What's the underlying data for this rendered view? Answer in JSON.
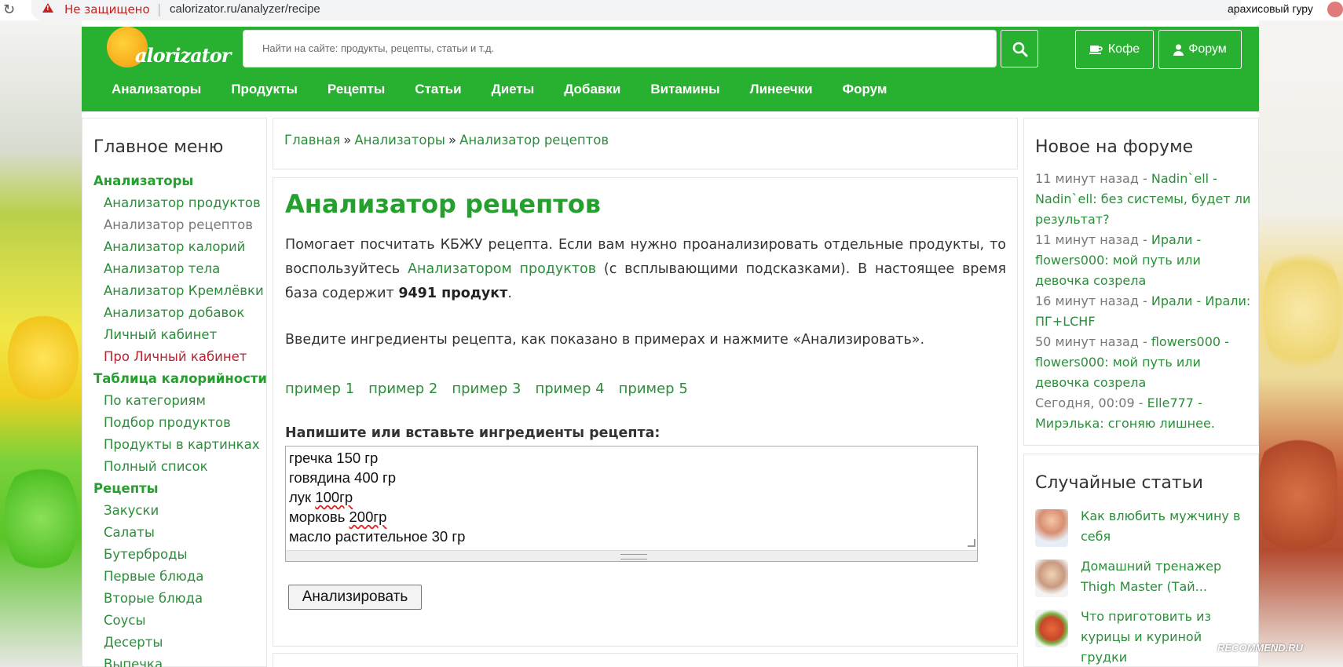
{
  "browser": {
    "not_secure": "Не защищено",
    "url": "calorizator.ru/analyzer/recipe",
    "profile_name": "арахисовый гуру"
  },
  "header": {
    "logo_text": "alorizator",
    "search_placeholder": "Найти на сайте: продукты, рецепты, статьи и т.д.",
    "coffee_label": "Кофе",
    "forum_label": "Форум",
    "nav": [
      "Анализаторы",
      "Продукты",
      "Рецепты",
      "Статьи",
      "Диеты",
      "Добавки",
      "Витамины",
      "Линеечки",
      "Форум"
    ]
  },
  "sidebar": {
    "title": "Главное меню",
    "items": [
      {
        "label": "Анализаторы",
        "kind": "cat"
      },
      {
        "label": "Анализатор продуктов",
        "kind": "sub"
      },
      {
        "label": "Анализатор рецептов",
        "kind": "sub-grey"
      },
      {
        "label": "Анализатор калорий",
        "kind": "sub"
      },
      {
        "label": "Анализатор тела",
        "kind": "sub"
      },
      {
        "label": "Анализатор Кремлёвки",
        "kind": "sub"
      },
      {
        "label": "Анализатор добавок",
        "kind": "sub"
      },
      {
        "label": "Личный кабинет",
        "kind": "sub"
      },
      {
        "label": "Про Личный кабинет",
        "kind": "sub-red"
      },
      {
        "label": "Таблица калорийности",
        "kind": "cat"
      },
      {
        "label": "По категориям",
        "kind": "sub"
      },
      {
        "label": "Подбор продуктов",
        "kind": "sub"
      },
      {
        "label": "Продукты в картинках",
        "kind": "sub"
      },
      {
        "label": "Полный список",
        "kind": "sub"
      },
      {
        "label": "Рецепты",
        "kind": "cat"
      },
      {
        "label": "Закуски",
        "kind": "sub"
      },
      {
        "label": "Салаты",
        "kind": "sub"
      },
      {
        "label": "Бутерброды",
        "kind": "sub"
      },
      {
        "label": "Первые блюда",
        "kind": "sub"
      },
      {
        "label": "Вторые блюда",
        "kind": "sub"
      },
      {
        "label": "Соусы",
        "kind": "sub"
      },
      {
        "label": "Десерты",
        "kind": "sub"
      },
      {
        "label": "Выпечка",
        "kind": "sub"
      }
    ]
  },
  "breadcrumb": {
    "home": "Главная",
    "sep": "»",
    "analyzers": "Анализаторы",
    "current": "Анализатор рецептов"
  },
  "main": {
    "title": "Анализатор рецептов",
    "intro_1": "Помогает посчитать КБЖУ рецепта. Если вам нужно проанализировать отдельные продукты, то воспользуйтесь ",
    "intro_link": "Анализатором продуктов",
    "intro_2": " (с всплывающими подсказками). В настоящее время база содержит ",
    "intro_count": "9491 продукт",
    "intro_end": ".",
    "instructions": "Введите ингредиенты рецепта, как показано в примерах и нажмите «Анализировать».",
    "examples": [
      "пример 1",
      "пример 2",
      "пример 3",
      "пример 4",
      "пример 5"
    ],
    "input_label": "Напишите или вставьте ингредиенты рецепта:",
    "ingredients": {
      "l1": "гречка 150 гр",
      "l2": "говядина 400 гр",
      "l3a": "лук ",
      "l3b": "100гр",
      "l4a": "морковь ",
      "l4b": "200гр",
      "l5": "масло растительное 30 гр"
    },
    "button": "Анализировать"
  },
  "forum": {
    "title": "Новое на форуме",
    "posts": [
      {
        "time": "11 минут назад",
        "dash": " - ",
        "text": "Nadin`ell - Nadin`ell: без системы, будет ли результат?"
      },
      {
        "time": "11 минут назад",
        "dash": " - ",
        "text": "Ирали - flowers000: мой путь или девочка созрела"
      },
      {
        "time": "16 минут назад",
        "dash": " - ",
        "text": "Ирали - Ирали: ПГ+LCHF"
      },
      {
        "time": "50 минут назад",
        "dash": " - ",
        "text": "flowers000 - flowers000: мой путь или девочка созрела"
      },
      {
        "time": "Сегодня, 00:09",
        "dash": " - ",
        "text": "Elle777 - Мирэлька: сгоняю лишнее."
      }
    ]
  },
  "articles": {
    "title": "Случайные статьи",
    "items": [
      {
        "text": "Как влюбить мужчину в себя"
      },
      {
        "text": "Домашний тренажер Thigh Master (Тай..."
      },
      {
        "text": "Что приготовить из курицы и куриной грудки"
      }
    ]
  },
  "watermark": "RECOMMEND.RU"
}
